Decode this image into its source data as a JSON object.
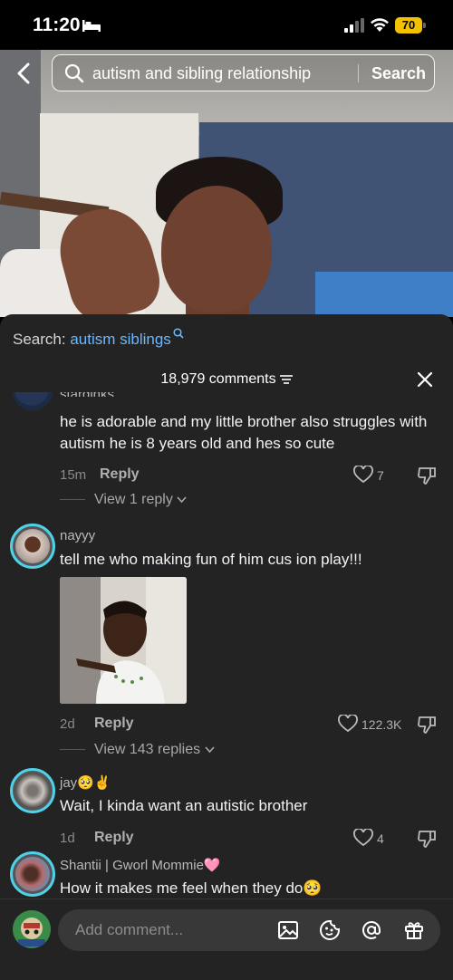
{
  "status_bar": {
    "time": "11:20",
    "battery": "70"
  },
  "search": {
    "query": "autism and sibling relationship",
    "button_label": "Search"
  },
  "sheet": {
    "related_prefix": "Search: ",
    "related_term": "autism siblings",
    "comment_count": "18,979 comments"
  },
  "comments": [
    {
      "username": "starginks",
      "text": "he is adorable and my little brother also struggles with autism he is 8 years old and hes so cute",
      "time": "15m",
      "reply_label": "Reply",
      "likes": "7",
      "view_replies": "View 1 reply"
    },
    {
      "username": "nayyy",
      "text": "tell me who making fun of him cus ion play!!!",
      "time": "2d",
      "reply_label": "Reply",
      "likes": "122.3K",
      "view_replies": "View 143 replies"
    },
    {
      "username": "jay🥺✌️",
      "text": "Wait, I kinda want an autistic brother",
      "time": "1d",
      "reply_label": "Reply",
      "likes": "4"
    },
    {
      "username": "Shantii | Gworl Mommie🩷",
      "text": "How it makes me feel when they do🥺"
    }
  ],
  "composer": {
    "placeholder": "Add comment..."
  },
  "colors": {
    "accent_link": "#6cb7ff",
    "avatar_ring": "#4fd1e8",
    "battery": "#f2c200"
  }
}
